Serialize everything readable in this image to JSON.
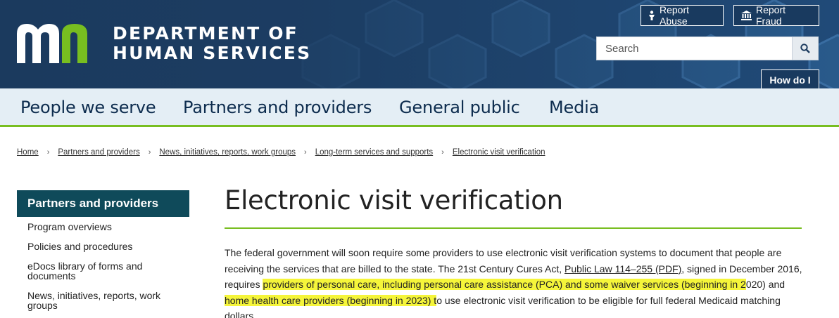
{
  "header": {
    "dept_line1": "DEPARTMENT OF",
    "dept_line2": "HUMAN SERVICES",
    "report_abuse": "Report Abuse",
    "report_fraud": "Report Fraud",
    "search_placeholder": "Search",
    "how_do_i": "How do I",
    "colors": {
      "navy": "#1b3a5e",
      "logo_green": "#78be20"
    }
  },
  "nav": {
    "items": [
      "People we serve",
      "Partners and providers",
      "General public",
      "Media"
    ]
  },
  "breadcrumb": {
    "items": [
      "Home",
      "Partners and providers",
      "News, initiatives, reports, work groups",
      "Long-term services and supports",
      "Electronic visit verification"
    ],
    "separator": "›"
  },
  "sidebar": {
    "title": "Partners and providers",
    "links": [
      "Program overviews",
      "Policies and procedures",
      "eDocs library of forms and documents",
      "News, initiatives, reports, work groups"
    ]
  },
  "main": {
    "title": "Electronic visit verification",
    "p1": "The federal government will soon require some providers to use electronic visit verification systems to document that people are receiving the services that are billed to the state. The 21st Century Cures Act, ",
    "link": "Public Law 114–255 (PDF)",
    "p2": ", signed in December 2016, requires ",
    "hl1": "providers of personal care, including personal care assistance (PCA) and some waiver services (beginning in 2",
    "p3": "020) and ",
    "hl2": "home health care providers (beginning in 2023) t",
    "p4": "o use electronic visit verification to be eligible for full federal Medicaid matching dollars.",
    "highlight_color": "#f5f53a"
  }
}
